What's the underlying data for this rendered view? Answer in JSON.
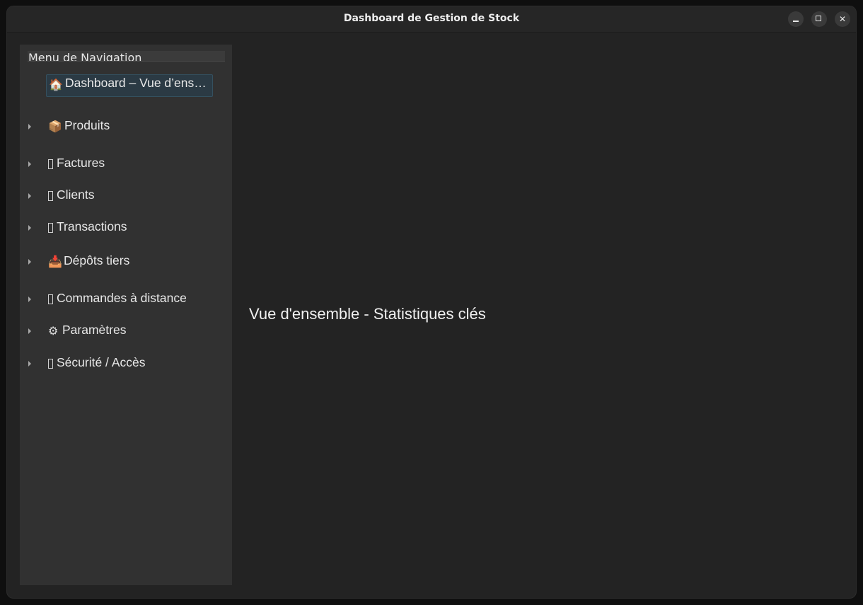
{
  "window": {
    "title": "Dashboard de Gestion de Stock",
    "controls": {
      "minimize": "minimize-icon",
      "maximize": "maximize-icon",
      "close": "close-icon"
    }
  },
  "sidebar": {
    "header": "Menu de Navigation",
    "items": [
      {
        "icon": "house-icon",
        "icon_glyph": "🏠",
        "label": "Dashboard – Vue d’ens…",
        "selected": true,
        "expandable": false
      },
      {
        "icon": "package-icon",
        "icon_glyph": "📦",
        "label": "Produits",
        "selected": false,
        "expandable": true
      },
      {
        "icon": "invoice-icon",
        "icon_glyph": "",
        "label": "Factures",
        "selected": false,
        "expandable": true
      },
      {
        "icon": "clients-icon",
        "icon_glyph": "",
        "label": "Clients",
        "selected": false,
        "expandable": true
      },
      {
        "icon": "transactions-icon",
        "icon_glyph": "",
        "label": "Transactions",
        "selected": false,
        "expandable": true
      },
      {
        "icon": "inbox-tray-icon",
        "icon_glyph": "📥",
        "label": "Dépôts tiers",
        "selected": false,
        "expandable": true
      },
      {
        "icon": "remote-orders-icon",
        "icon_glyph": "",
        "label": "Commandes à distance",
        "selected": false,
        "expandable": true
      },
      {
        "icon": "gear-icon",
        "icon_glyph": "⚙",
        "label": "Paramètres",
        "selected": false,
        "expandable": true
      },
      {
        "icon": "security-icon",
        "icon_glyph": "",
        "label": "Sécurité / Accès",
        "selected": false,
        "expandable": true
      }
    ]
  },
  "main": {
    "heading": "Vue d'ensemble - Statistiques clés"
  },
  "colors": {
    "window_bg": "#232323",
    "sidebar_bg": "#313131",
    "selection_bg": "#2b3a44",
    "text": "#e8e8e8"
  }
}
